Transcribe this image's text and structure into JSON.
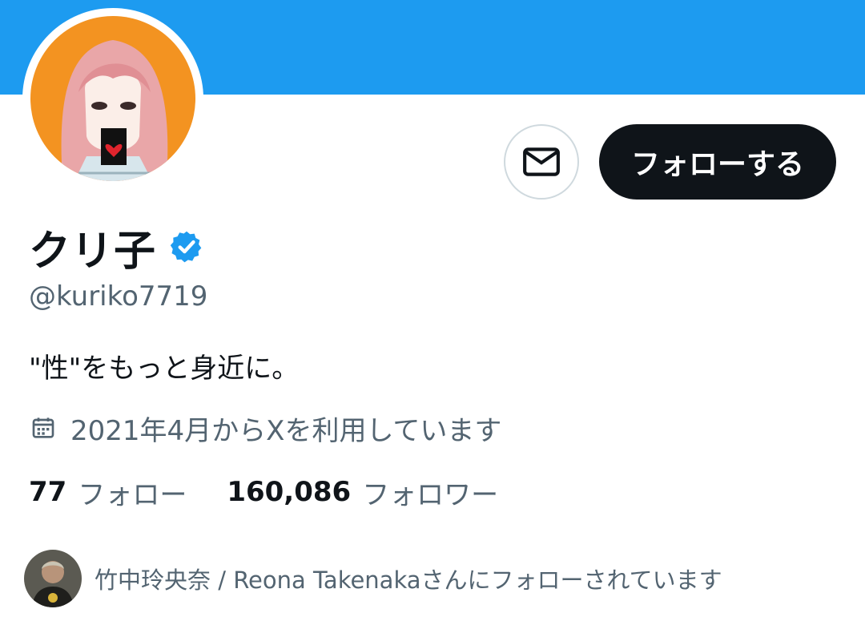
{
  "profile": {
    "display_name": "クリ子",
    "handle": "@kuriko7719",
    "bio": "\"性\"をもっと身近に。",
    "joined": "2021年4月からXを利用しています",
    "verified_icon": "verified-badge-icon"
  },
  "actions": {
    "message_icon": "mail-icon",
    "follow_label": "フォローする"
  },
  "stats": {
    "following_count": "77",
    "following_label": "フォロー",
    "followers_count": "160,086",
    "followers_label": "フォロワー"
  },
  "followed_by": {
    "text": "竹中玲央奈 / Reona Takenakaさんにフォローされています"
  },
  "colors": {
    "banner": "#1d9bf0",
    "accent": "#1d9bf0",
    "primary_text": "#0f1419",
    "secondary_text": "#536471",
    "follow_button_bg": "#0f1419",
    "avatar_background": "#f39321"
  }
}
